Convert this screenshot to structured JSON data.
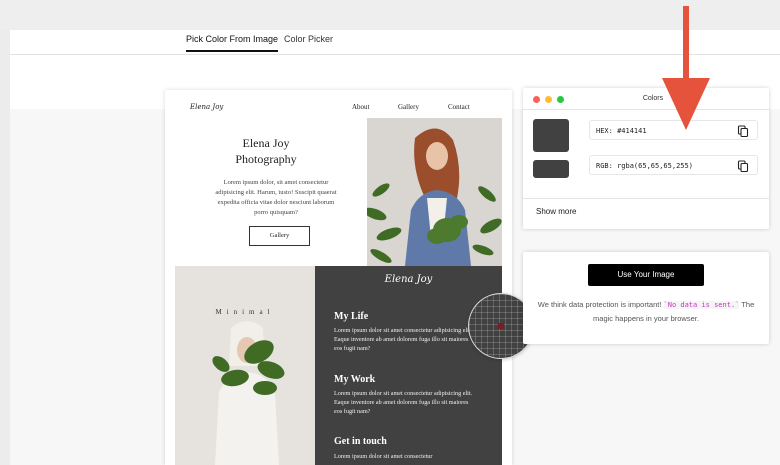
{
  "tabs": [
    {
      "label": "Pick Color From Image",
      "active": true
    },
    {
      "label": "Color Picker",
      "active": false
    }
  ],
  "preview": {
    "logo": "Elena Joy",
    "nav": [
      "About",
      "Gallery",
      "Contact"
    ],
    "hero_title_line1": "Elena Joy",
    "hero_title_line2": "Photography",
    "hero_body": "Lorem ipsum dolor, sit amet consectetur adipisicing elit. Harum, iusto! Suscipit quaerat expedita officia vitae dolor nesciunt laborum porro quisquam?",
    "hero_button": "Gallery",
    "minimal_label": "Minimal",
    "dark_logo": "Elena Joy",
    "sections": [
      {
        "heading": "My Life",
        "body": "Lorem ipsum dolor sit amet consectetur adipisicing elit. Eaque inventore ab amet dolorem fuga illo sit maiores eos fugit nam?"
      },
      {
        "heading": "My Work",
        "body": "Lorem ipsum dolor sit amet consectetur adipisicing elit. Eaque inventore ab amet dolorem fuga illo sit maiores eos fugit nam?"
      },
      {
        "heading": "Get in touch",
        "body": "Lorem ipsum dolor sit amet consectetur"
      }
    ]
  },
  "colors_panel": {
    "title": "Colors",
    "hex_value": "HEX: #414141",
    "rgb_value": "RGB: rgba(65,65,65,255)",
    "show_more": "Show more",
    "picked_color": "#414141",
    "window_dots": [
      "#ff5f57",
      "#febc2e",
      "#28c840"
    ]
  },
  "use_panel": {
    "button": "Use Your Image",
    "text_before": "We think data protection is important! ",
    "code_text": "`No data is sent.`",
    "text_after": " The magic happens in your browser."
  },
  "annotation_arrow_color": "#e5533d"
}
